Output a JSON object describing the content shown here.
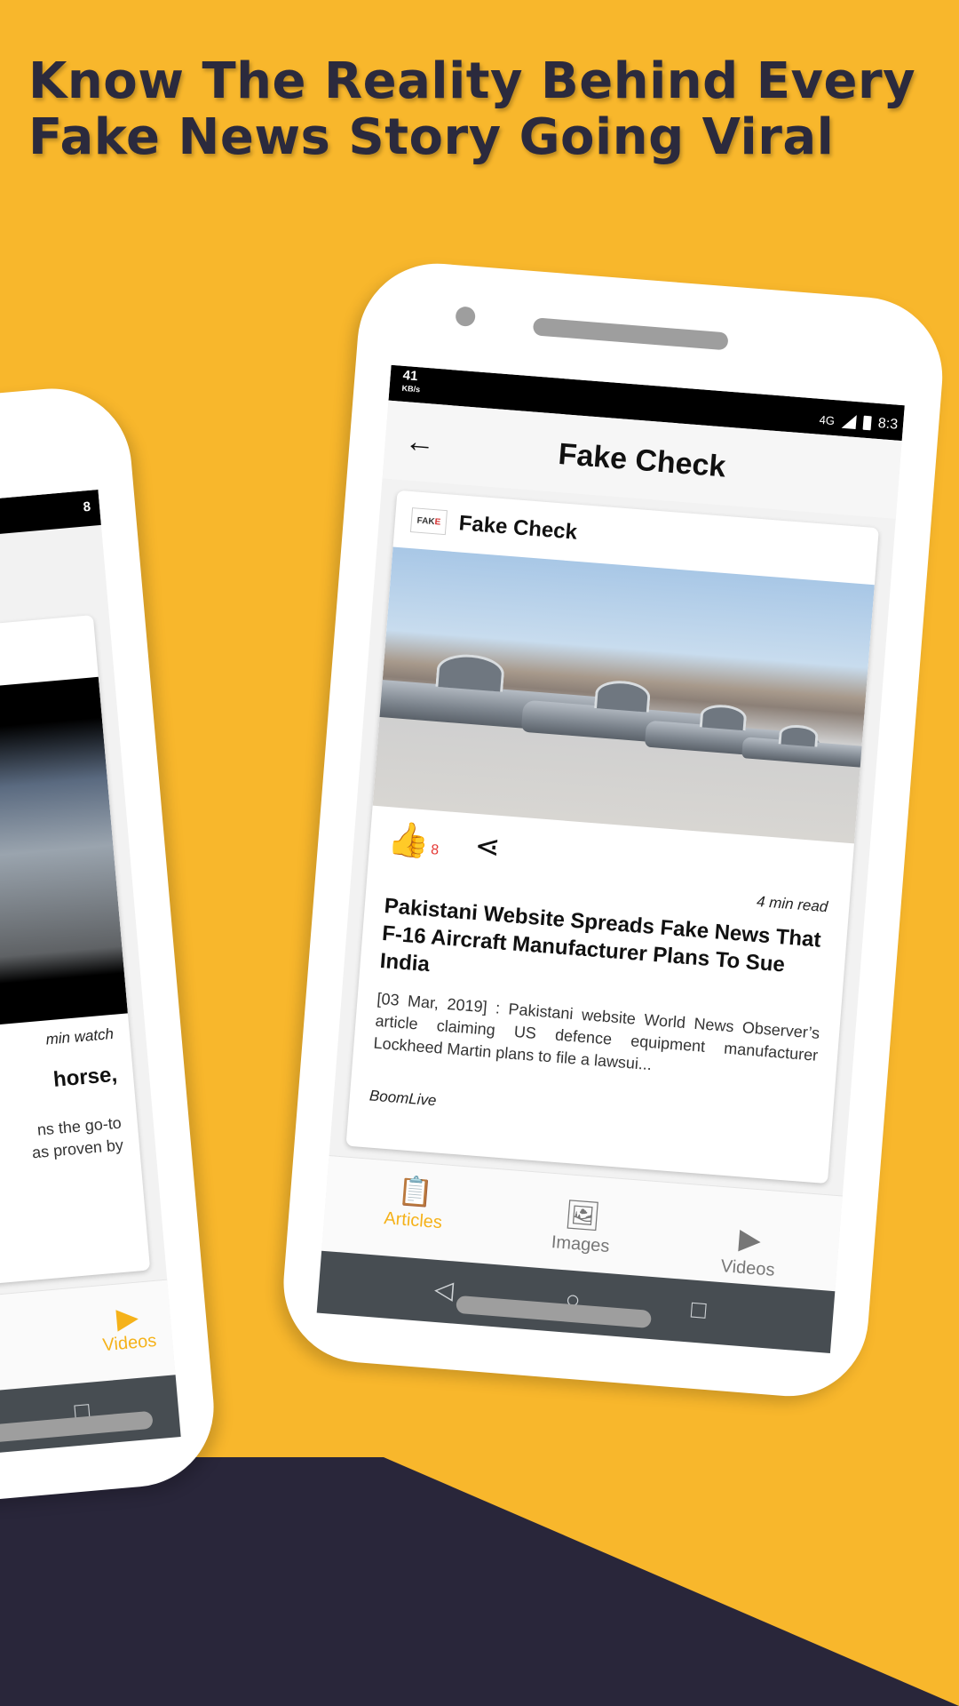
{
  "headline": {
    "line1": "Know The Reality Behind Every",
    "line2": "Fake News Story Going Viral"
  },
  "phone": {
    "status": {
      "speed": "41",
      "speed_unit": "KB/s",
      "network": "4G",
      "time": "8:3"
    },
    "app_bar": {
      "back_icon": "←",
      "title": "Fake Check"
    },
    "card": {
      "logo_text_1": "FAK",
      "logo_text_2": "E",
      "source": "Fake Check",
      "like_icon": "👍",
      "like_count": "8",
      "share_icon": "⋖",
      "read_time": "4 min read",
      "title": "Pakistani Website Spreads Fake News That F-16 Aircraft Manufacturer Plans To Sue India",
      "body": "[03 Mar, 2019] : Pakistani website World News Observer’s article claiming US defence equipment manufacturer Lockheed Martin plans to file a lawsui...",
      "publisher": "BoomLive"
    },
    "bottom_nav": [
      {
        "label": "Articles",
        "icon": "📋"
      },
      {
        "label": "Images",
        "icon": "🖼"
      },
      {
        "label": "Videos",
        "icon": "▶"
      }
    ],
    "android_nav": {
      "back": "◁",
      "home": "○",
      "recent": "□"
    }
  },
  "phone_left": {
    "status_text": "8",
    "watch_text": "min watch",
    "title_fragment": "horse,",
    "body_fragment_1": "ns the go-to",
    "body_fragment_2": "as proven by",
    "nav_label": "Videos",
    "nav_icon": "▶",
    "recent_icon": "□"
  },
  "colors": {
    "background": "#F8B72C",
    "dark_wedge": "#29263A",
    "accent": "#F5B21A",
    "like_red": "#e53935"
  }
}
